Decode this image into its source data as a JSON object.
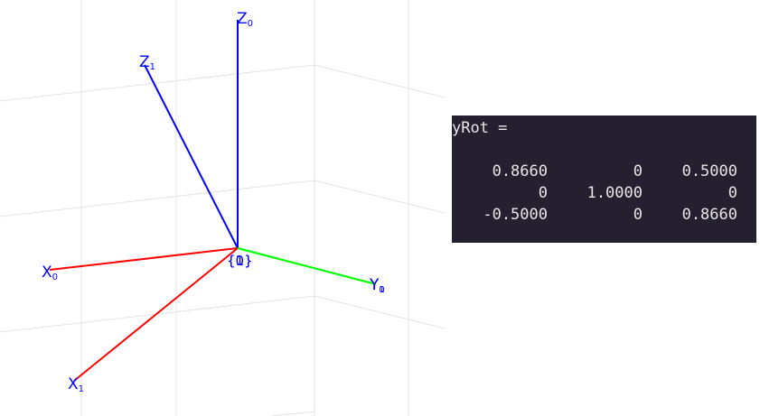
{
  "plot": {
    "frames": [
      {
        "name": "frame-0",
        "axes": [
          {
            "axis": "X",
            "sub": "0",
            "color": "#ff0000"
          },
          {
            "axis": "Y",
            "sub": "0",
            "color": "#00ff00"
          },
          {
            "axis": "Z",
            "sub": "0",
            "color": "#0000ff"
          }
        ]
      },
      {
        "name": "frame-1",
        "axes": [
          {
            "axis": "X",
            "sub": "1",
            "color": "#ff0000"
          },
          {
            "axis": "Y",
            "sub": "1",
            "color": "#00ff00"
          },
          {
            "axis": "Z",
            "sub": "1",
            "color": "#0000ff"
          }
        ]
      }
    ],
    "origin_label": "{0}",
    "origin_label_overlay": "{1}",
    "label_color": "#0000ff"
  },
  "console": {
    "header": "yRot =",
    "matrix": [
      [
        "0.8660",
        "0",
        "0.5000"
      ],
      [
        "0",
        "1.0000",
        "0"
      ],
      [
        "-0.5000",
        "0",
        "0.8660"
      ]
    ]
  }
}
